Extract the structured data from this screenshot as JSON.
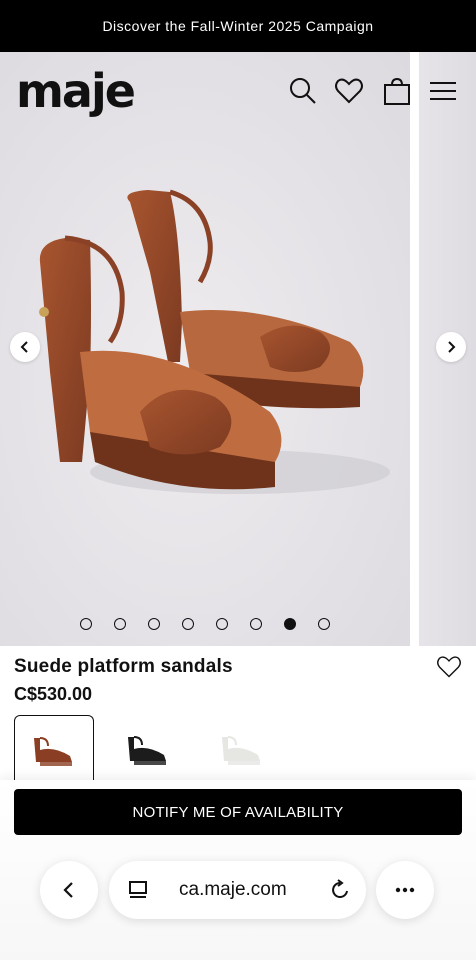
{
  "promo": {
    "text": "Discover the Fall-Winter 2025 Campaign"
  },
  "header": {
    "logo": "maje",
    "icons": [
      "search-icon",
      "heart-icon",
      "bag-icon",
      "menu-icon"
    ]
  },
  "gallery": {
    "dot_count": 8,
    "active_dot": 7
  },
  "product": {
    "title": "Suede platform sandals",
    "price": "C$530.00",
    "swatches": [
      {
        "name": "brown",
        "color": "#8a3f24",
        "selected": true
      },
      {
        "name": "black",
        "color": "#1c1c1c",
        "selected": false
      },
      {
        "name": "white",
        "color": "#e6e6e3",
        "selected": false
      }
    ]
  },
  "cta": {
    "label": "NOTIFY ME OF AVAILABILITY"
  },
  "browser": {
    "url": "ca.maje.com"
  },
  "colors": {
    "shoe": "#9c4b2b",
    "shoe_dark": "#7a3820",
    "promo_bg": "#000000"
  }
}
